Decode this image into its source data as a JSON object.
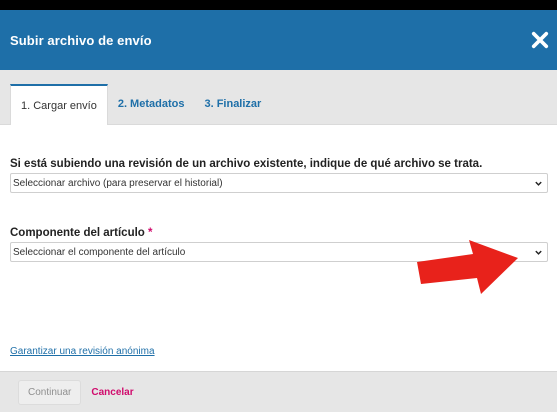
{
  "dialog": {
    "title": "Subir archivo de envío"
  },
  "tabs": [
    {
      "label": "1. Cargar envío",
      "active": true
    },
    {
      "label": "2. Metadatos",
      "active": false
    },
    {
      "label": "3. Finalizar",
      "active": false
    }
  ],
  "fields": {
    "revision": {
      "label": "Si está subiendo una revisión de un archivo existente, indique de qué archivo se trata.",
      "selected": "Seleccionar archivo (para preservar el historial)"
    },
    "component": {
      "label": "Componente del artículo",
      "required_mark": "*",
      "selected": "Seleccionar el componente del artículo"
    }
  },
  "links": {
    "anonymous_review": "Garantizar una revisión anónima"
  },
  "footer": {
    "continue_label": "Continuar",
    "cancel_label": "Cancelar"
  },
  "colors": {
    "header": "#1e6fa8",
    "accent_link": "#1e6fa8",
    "required": "#d00a6c",
    "annotation_arrow": "#e8221b"
  },
  "icons": {
    "close": "close-icon",
    "dropdown": "chevron-down-icon",
    "annotation": "red-arrow-annotation"
  }
}
